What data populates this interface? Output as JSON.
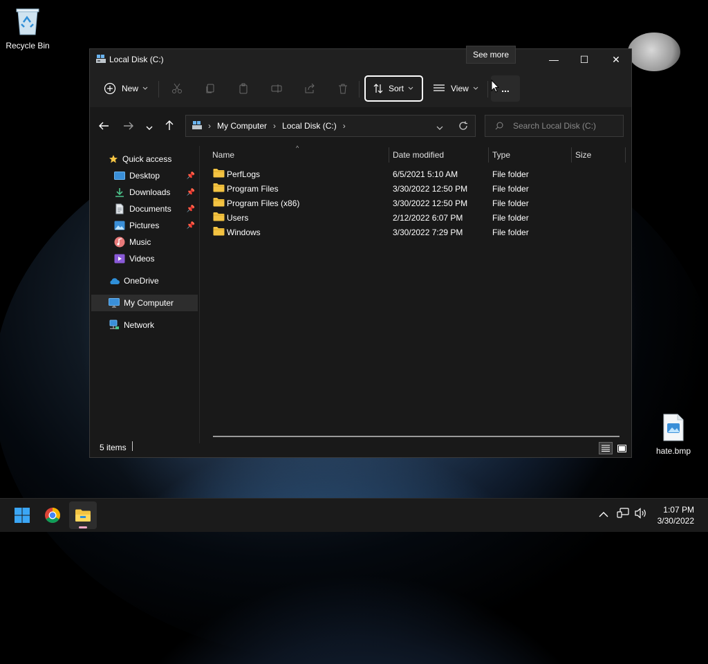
{
  "desktop": {
    "icons": [
      {
        "label": "Recycle Bin"
      },
      {
        "label": "hate.bmp"
      }
    ]
  },
  "window": {
    "title": "Local Disk (C:)",
    "controls": {
      "minimize": "—",
      "maximize": "☐",
      "close": "✕"
    }
  },
  "toolbar": {
    "new_label": "New",
    "sort_label": "Sort",
    "view_label": "View",
    "more_label": "...",
    "tooltip": "See more"
  },
  "navigation": {
    "breadcrumb": [
      "My Computer",
      "Local Disk (C:)"
    ],
    "search_placeholder": "Search Local Disk (C:)"
  },
  "sidebar": {
    "items": [
      {
        "label": "Quick access"
      },
      {
        "label": "Desktop"
      },
      {
        "label": "Downloads"
      },
      {
        "label": "Documents"
      },
      {
        "label": "Pictures"
      },
      {
        "label": "Music"
      },
      {
        "label": "Videos"
      },
      {
        "label": "OneDrive"
      },
      {
        "label": "My Computer"
      },
      {
        "label": "Network"
      }
    ]
  },
  "file_list": {
    "columns": [
      "Name",
      "Date modified",
      "Type",
      "Size"
    ],
    "rows": [
      {
        "name": "PerfLogs",
        "date": "6/5/2021 5:10 AM",
        "type": "File folder"
      },
      {
        "name": "Program Files",
        "date": "3/30/2022 12:50 PM",
        "type": "File folder"
      },
      {
        "name": "Program Files (x86)",
        "date": "3/30/2022 12:50 PM",
        "type": "File folder"
      },
      {
        "name": "Users",
        "date": "2/12/2022 6:07 PM",
        "type": "File folder"
      },
      {
        "name": "Windows",
        "date": "3/30/2022 7:29 PM",
        "type": "File folder"
      }
    ]
  },
  "status": {
    "item_count": "5 items"
  },
  "taskbar": {
    "time": "1:07 PM",
    "date": "3/30/2022"
  },
  "colors": {
    "window_bg": "#191919",
    "titlebar_bg": "#202020",
    "folder_yellow": "#f3c342",
    "accent_blue": "#4aa3f0"
  }
}
